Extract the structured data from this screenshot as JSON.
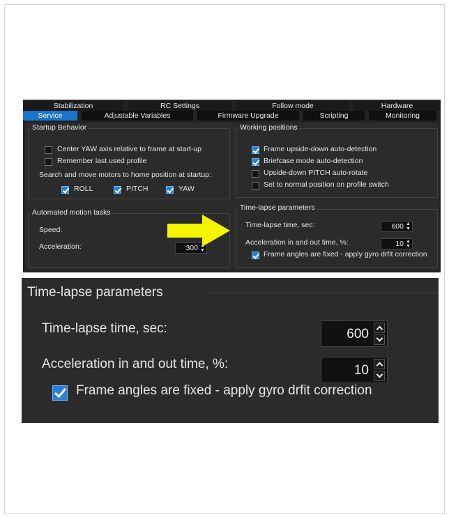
{
  "tabs_row1": [
    "Stabilization",
    "RC Settings",
    "Follow mode",
    "Hardware"
  ],
  "tabs_row2": [
    "Service",
    "Adjustable Variables",
    "Firmware Upgrade",
    "Scripting",
    "Monitoring"
  ],
  "active_tab": "Service",
  "startup": {
    "title": "Startup Behavior",
    "center_yaw": {
      "label": "Center YAW axis relative to frame at start-up",
      "checked": false
    },
    "remember": {
      "label": "Remember last used profile",
      "checked": false
    },
    "search_label": "Search and move motors to home position at startup:",
    "roll": {
      "label": "ROLL",
      "checked": true
    },
    "pitch": {
      "label": "PITCH",
      "checked": true
    },
    "yaw": {
      "label": "YAW",
      "checked": true
    }
  },
  "motion": {
    "title": "Automated motion tasks",
    "speed_label": "Speed:",
    "accel_label": "Acceleration:",
    "accel_value": "300"
  },
  "working": {
    "title": "Working positions",
    "upside_down": {
      "label": "Frame upside-down auto-detection",
      "checked": true
    },
    "briefcase": {
      "label": "Briefcase mode auto-detection",
      "checked": true
    },
    "pitch_rotate": {
      "label": "Upside-down PITCH auto-rotate",
      "checked": false
    },
    "normal_pos": {
      "label": "Set to normal position on profile switch",
      "checked": false
    }
  },
  "timelapse": {
    "title": "Time-lapse parameters",
    "time_label": "Time-lapse time, sec:",
    "time_value": "600",
    "accel_label": "Acceleration in and out time, %:",
    "accel_value": "10",
    "fixed": {
      "label": "Frame angles are fixed - apply gyro drfit correction",
      "checked": true
    }
  },
  "colors": {
    "accent": "#1a74cc",
    "arrow": "#f5f500",
    "panel": "#2b2b2b"
  },
  "icons": [
    "checkbox-checked-icon",
    "checkbox-empty-icon",
    "spin-up-icon",
    "spin-down-icon",
    "arrow-right-icon"
  ]
}
